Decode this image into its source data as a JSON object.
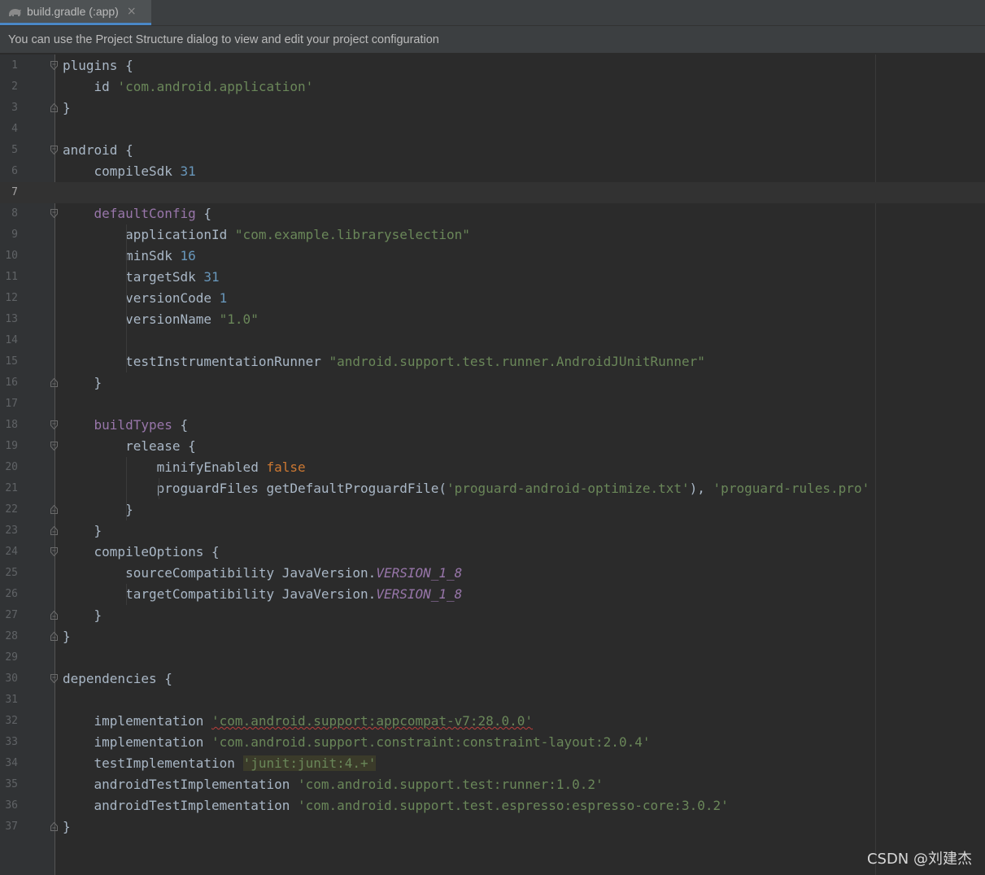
{
  "tab": {
    "label": "build.gradle (:app)",
    "close": "×",
    "icon": "gradle-elephant-icon"
  },
  "banner": {
    "text": "You can use the Project Structure dialog to view and edit your project configuration"
  },
  "current_line": 7,
  "lines": [
    {
      "n": "1",
      "fold": "open",
      "tokens": [
        [
          "plugins {",
          "p"
        ]
      ]
    },
    {
      "n": "2",
      "fold": "",
      "tokens": [
        [
          "    id ",
          "p"
        ],
        [
          "'com.android.application'",
          "s"
        ]
      ]
    },
    {
      "n": "3",
      "fold": "close",
      "tokens": [
        [
          "}",
          "p"
        ]
      ]
    },
    {
      "n": "4",
      "fold": "",
      "tokens": []
    },
    {
      "n": "5",
      "fold": "open",
      "tokens": [
        [
          "android {",
          "p"
        ]
      ]
    },
    {
      "n": "6",
      "fold": "",
      "tokens": [
        [
          "    compileSdk ",
          "p"
        ],
        [
          "31",
          "n"
        ]
      ]
    },
    {
      "n": "7",
      "fold": "",
      "tokens": []
    },
    {
      "n": "8",
      "fold": "open",
      "tokens": [
        [
          "    ",
          "p"
        ],
        [
          "defaultConfig",
          "m"
        ],
        [
          " {",
          "p"
        ]
      ]
    },
    {
      "n": "9",
      "fold": "",
      "tokens": [
        [
          "        applicationId ",
          "p"
        ],
        [
          "\"com.example.libraryselection\"",
          "s"
        ]
      ]
    },
    {
      "n": "10",
      "fold": "",
      "tokens": [
        [
          "        minSdk ",
          "p"
        ],
        [
          "16",
          "n"
        ]
      ]
    },
    {
      "n": "11",
      "fold": "",
      "tokens": [
        [
          "        targetSdk ",
          "p"
        ],
        [
          "31",
          "n"
        ]
      ]
    },
    {
      "n": "12",
      "fold": "",
      "tokens": [
        [
          "        versionCode ",
          "p"
        ],
        [
          "1",
          "n"
        ]
      ]
    },
    {
      "n": "13",
      "fold": "",
      "tokens": [
        [
          "        versionName ",
          "p"
        ],
        [
          "\"1.0\"",
          "s"
        ]
      ]
    },
    {
      "n": "14",
      "fold": "",
      "tokens": []
    },
    {
      "n": "15",
      "fold": "",
      "tokens": [
        [
          "        testInstrumentationRunner ",
          "p"
        ],
        [
          "\"android.support.test.runner.AndroidJUnitRunner\"",
          "s"
        ]
      ]
    },
    {
      "n": "16",
      "fold": "close",
      "tokens": [
        [
          "    }",
          "p"
        ]
      ]
    },
    {
      "n": "17",
      "fold": "",
      "tokens": []
    },
    {
      "n": "18",
      "fold": "open",
      "tokens": [
        [
          "    ",
          "p"
        ],
        [
          "buildTypes",
          "m"
        ],
        [
          " {",
          "p"
        ]
      ]
    },
    {
      "n": "19",
      "fold": "open",
      "tokens": [
        [
          "        release {",
          "p"
        ]
      ]
    },
    {
      "n": "20",
      "fold": "",
      "tokens": [
        [
          "            minifyEnabled ",
          "p"
        ],
        [
          "false",
          "k"
        ]
      ]
    },
    {
      "n": "21",
      "fold": "",
      "tokens": [
        [
          "            proguardFiles getDefaultProguardFile(",
          "p"
        ],
        [
          "'proguard-android-optimize.txt'",
          "s"
        ],
        [
          "), ",
          "p"
        ],
        [
          "'proguard-rules.pro'",
          "s"
        ]
      ]
    },
    {
      "n": "22",
      "fold": "close",
      "tokens": [
        [
          "        }",
          "p"
        ]
      ]
    },
    {
      "n": "23",
      "fold": "close",
      "tokens": [
        [
          "    }",
          "p"
        ]
      ]
    },
    {
      "n": "24",
      "fold": "open",
      "tokens": [
        [
          "    compileOptions {",
          "p"
        ]
      ]
    },
    {
      "n": "25",
      "fold": "",
      "tokens": [
        [
          "        sourceCompatibility JavaVersion.",
          "p"
        ],
        [
          "VERSION_1_8",
          "i"
        ]
      ]
    },
    {
      "n": "26",
      "fold": "",
      "tokens": [
        [
          "        targetCompatibility JavaVersion.",
          "p"
        ],
        [
          "VERSION_1_8",
          "i"
        ]
      ]
    },
    {
      "n": "27",
      "fold": "close",
      "tokens": [
        [
          "    }",
          "p"
        ]
      ]
    },
    {
      "n": "28",
      "fold": "close",
      "tokens": [
        [
          "}",
          "p"
        ]
      ]
    },
    {
      "n": "29",
      "fold": "",
      "tokens": []
    },
    {
      "n": "30",
      "fold": "open",
      "tokens": [
        [
          "dependencies {",
          "p"
        ]
      ]
    },
    {
      "n": "31",
      "fold": "",
      "tokens": []
    },
    {
      "n": "32",
      "fold": "",
      "tokens": [
        [
          "    implementation ",
          "p"
        ],
        [
          "'com.android.support:appcompat-v7:28.0.0'",
          "w"
        ]
      ]
    },
    {
      "n": "33",
      "fold": "",
      "tokens": [
        [
          "    implementation ",
          "p"
        ],
        [
          "'com.android.support.constraint:constraint-layout:2.0.4'",
          "s"
        ]
      ]
    },
    {
      "n": "34",
      "fold": "",
      "tokens": [
        [
          "    testImplementation ",
          "p"
        ],
        [
          "'junit:junit:4.+'",
          "h"
        ]
      ]
    },
    {
      "n": "35",
      "fold": "",
      "tokens": [
        [
          "    androidTestImplementation ",
          "p"
        ],
        [
          "'com.android.support.test:runner:1.0.2'",
          "s"
        ]
      ]
    },
    {
      "n": "36",
      "fold": "",
      "tokens": [
        [
          "    androidTestImplementation ",
          "p"
        ],
        [
          "'com.android.support.test.espresso:espresso-core:3.0.2'",
          "s"
        ]
      ]
    },
    {
      "n": "37",
      "fold": "close",
      "tokens": [
        [
          "}",
          "p"
        ]
      ]
    }
  ],
  "watermark": "CSDN @刘建杰",
  "colors": {
    "background": "#2b2b2b",
    "gutter": "#313335",
    "plain": "#a9b7c6",
    "string": "#6a8759",
    "number": "#6897bb",
    "keyword": "#cc7832",
    "method": "#9876aa"
  }
}
